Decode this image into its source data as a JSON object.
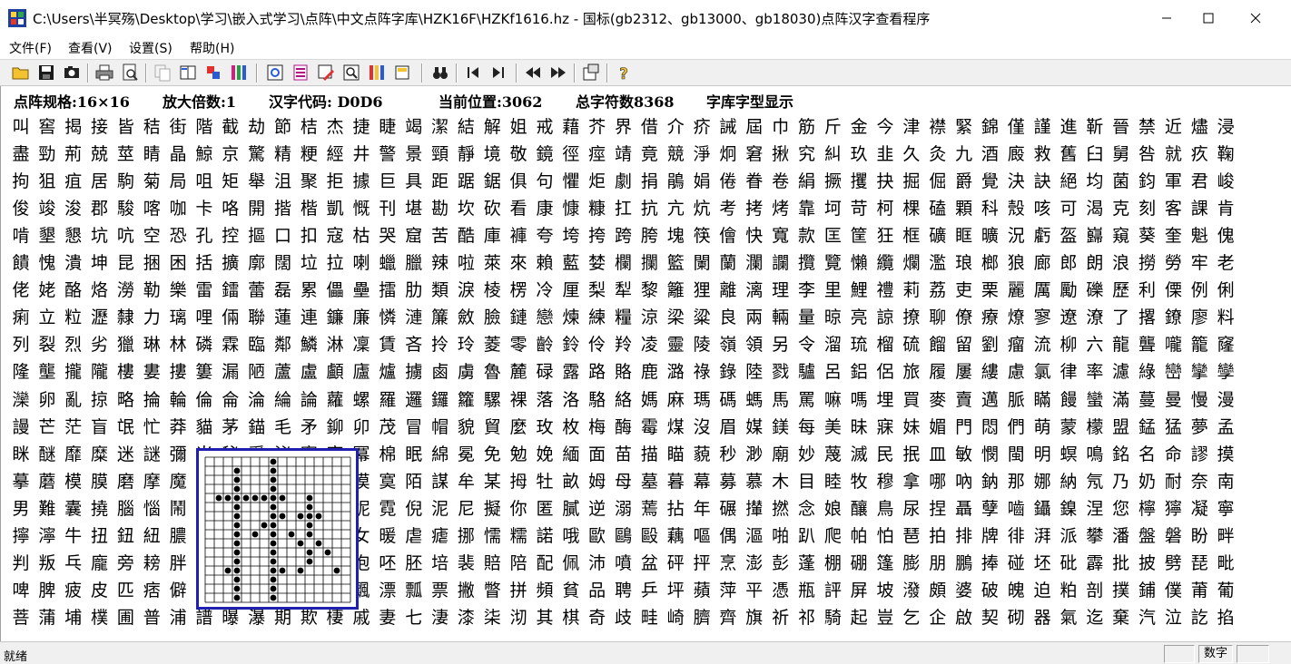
{
  "window": {
    "title": "C:\\Users\\半冥殇\\Desktop\\学习\\嵌入式学习\\点阵\\中文点阵字库\\HZK16F\\HZKf1616.hz - 国标(gb2312、gb13000、gb18030)点阵汉字查看程序",
    "minimize_icon": "minimize-icon",
    "maximize_icon": "maximize-icon",
    "close_icon": "close-icon"
  },
  "menu": [
    {
      "label": "文件(F)"
    },
    {
      "label": "查看(V)"
    },
    {
      "label": "设置(S)"
    },
    {
      "label": "帮助(H)"
    }
  ],
  "toolbar_icons": [
    "open-folder-icon",
    "save-icon",
    "camera-icon",
    "print-icon",
    "print-preview-icon",
    "copy-icon",
    "book-icon",
    "paint-icon",
    "palette-icon",
    "view-icon",
    "list-icon",
    "edit-icon",
    "zoom-icon",
    "font-icon",
    "export-icon",
    "binoculars-icon",
    "first-icon",
    "last-icon",
    "prev-icon",
    "next-icon",
    "properties-icon",
    "help-icon"
  ],
  "info": {
    "spec": "点阵规格:16×16",
    "zoom": "放大倍数:1",
    "code": "汉字代码: D0D6",
    "position": "当前位置:3062",
    "total": "总字符数8368",
    "mode": "字库字型显示"
  },
  "grid_rows": [
    "叫窖揭接皆秸街階截劫節桔杰捷睫竭潔結解姐戒藉芥界借介疥誡屆巾筋斤金今津襟緊錦僅謹進靳晉禁近燼浸",
    "盡勁荊兢莖睛晶鯨京驚精粳經井警景頸靜境敬鏡徑痙靖竟競淨炯窘揪究糾玖韭久灸九酒廄救舊臼舅咎就疚鞠",
    "拘狙疽居駒菊局咀矩舉沮聚拒據巨具距踞鋸俱句懼炬劇捐鵑娟倦眷卷絹撅攫抉掘倔爵覺決訣絕均菌鈞軍君峻",
    "俊竣浚郡駿喀咖卡咯開揩楷凱慨刊堪勘坎砍看康慷糠扛抗亢炕考拷烤靠坷苛柯棵磕顆科殼咳可渴克刻客課肯",
    "啃墾懇坑吭空恐孔控摳口扣寇枯哭窟苦酷庫褲夸垮挎跨胯塊筷儈快寬款匡筐狂框礦眶曠況虧盔巋窺葵奎魁傀",
    "饋愧潰坤昆捆困括擴廓闊垃拉喇蠟臘辣啦萊來賴藍婪欄攔籃闌蘭瀾讕攬覽懶纜爛濫琅榔狼廊郎朗浪撈勞牢老",
    "佬姥酪烙澇勒樂雷鐳蕾磊累儡壘擂肋類淚棱楞冷厘梨犁黎籬狸離漓理李里鯉禮莉荔吏栗麗厲勵礫歷利傈例俐",
    "痢立粒瀝隸力璃哩倆聯蓮連鐮廉憐漣簾斂臉鏈戀煉練糧涼梁粱良兩輛量晾亮諒撩聊僚療燎寥遼潦了撂鐐廖料",
    "列裂烈劣獵琳林磷霖臨鄰鱗淋凜賃吝拎玲菱零齡鈴伶羚凌靈陵嶺領另令溜琉榴硫餾留劉瘤流柳六龍聾嚨籠窿",
    "隆壟攏隴樓婁摟簍漏陋蘆盧顱廬爐擄鹵虜魯麓碌露路賂鹿潞祿錄陸戮驢呂鋁侶旅履屢縷慮氯律率濾綠巒攣孿",
    "灤卵亂掠略掄輪倫侖淪綸論蘿螺羅邏鑼籮騾裸落洛駱絡媽麻瑪碼螞馬罵嘛嗎埋買麥賣邁脈瞞饅蠻滿蔓曼慢漫",
    "謾芒茫盲氓忙莽貓茅錨毛矛鉚卯茂冒帽貌貿麼玫枚梅酶霉煤沒眉媒鎂每美昧寐妹媚門悶們萌蒙檬盟錳猛夢孟",
    "眯醚靡糜迷謎彌米秘覓泌蜜密冪棉眠綿冕免勉娩緬面苗描瞄藐秒渺廟妙蔑滅民抿皿敏憫閩明螟鳴銘名命謬摸",
    "摹蘑模膜磨摩魔抹末莫墨默沫漠寞陌謀牟某拇牡畝姆母墓暮幕募慕木目睦牧穆拿哪吶鈉那娜納氖乃奶耐奈南",
    "男難囊撓腦惱鬧淖呢餒內嫩能妮霓倪泥尼擬你匿膩逆溺蔫拈年碾攆撚念娘釀鳥尿捏聶孽嚙鑷鎳涅您檸獰凝寧",
    "擰濘牛扭鈕紐膿濃農弄奴努怒女暖虐瘧挪懦糯諾哦歐鷗毆藕嘔偶漚啪趴爬帕怕琶拍排牌徘湃派攀潘盤磐盼畔",
    "判叛乓龐旁耪胖拋咆刨炮袍跑泡呸胚培裴賠陪配佩沛噴盆砰抨烹澎彭蓬棚硼篷膨朋鵬捧碰坯砒霹批披劈琵毗",
    "啤脾疲皮匹痞僻屁譬篇偏片騙飄漂瓢票撇瞥拼頻貧品聘乒坪蘋萍平憑瓶評屏坡潑頗婆破魄迫粕剖撲鋪僕莆葡",
    "菩蒲埔樸圃普浦譜曝瀑期欺棲戚妻七淒漆柒沏其棋奇歧畦崎臍齊旗祈祁騎起豈乞企啟契砌器氣迄棄汽泣訖掐"
  ],
  "zoom_glyph": {
    "char": "殺",
    "bitmap": [
      "0000000100000000",
      "0001000100000000",
      "0001000100000000",
      "0001000100000000",
      "0111111110010000",
      "0001000100010000",
      "0001000110111000",
      "0001001100010000",
      "0001010101010000",
      "0001000100101000",
      "0001000100010100",
      "0001000100010000",
      "0011000110100010",
      "0001000100000000",
      "0001000100000000",
      "0001000100000000"
    ]
  },
  "status": {
    "ready": "就绪",
    "num_lock": "数字"
  }
}
